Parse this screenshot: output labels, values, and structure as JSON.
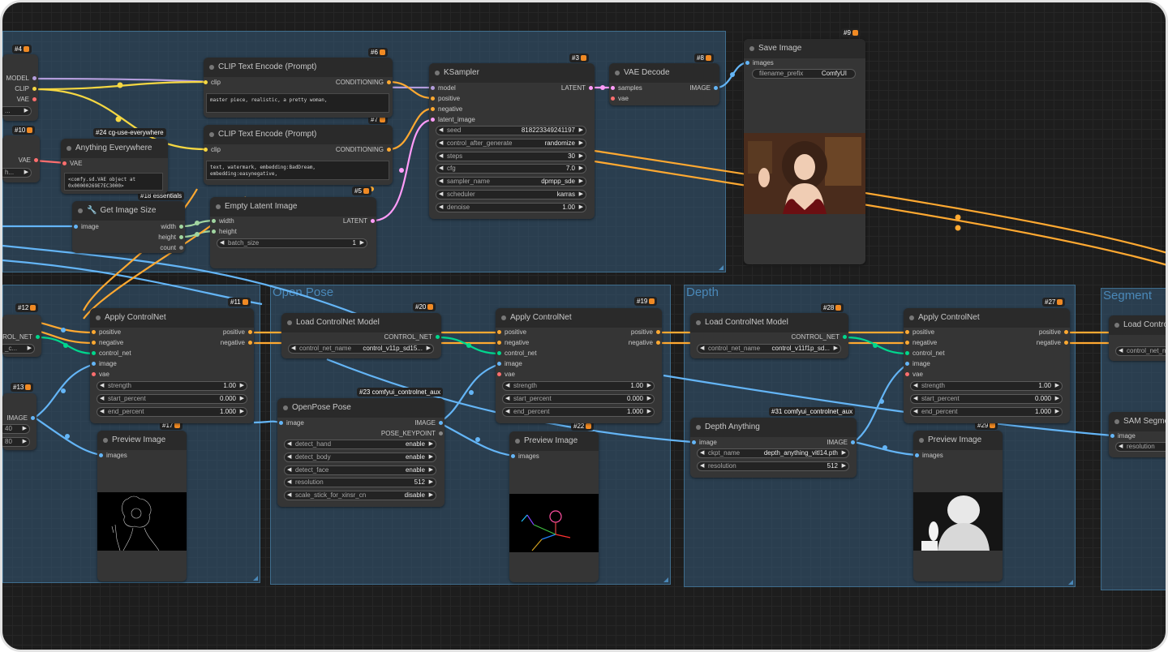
{
  "groups": {
    "openpose": "Open Pose",
    "depth": "Depth",
    "segment": "Segment"
  },
  "badges": {
    "n4": "#4",
    "n6": "#6",
    "n3": "#3",
    "n8": "#8",
    "n9": "#9",
    "n10": "#10",
    "n7": "#7",
    "n5": "#5",
    "n12": "#12",
    "n11": "#11",
    "n20": "#20",
    "n19": "#19",
    "n28": "#28",
    "n27": "#27",
    "n13": "#13",
    "n17": "#17",
    "n22": "#22",
    "n29": "#29"
  },
  "labels": {
    "cg_use_everywhere": "#24 cg-use-everywhere",
    "essentials": "#18 essentials",
    "openpose_aux": "#23 comfyui_controlnet_aux",
    "depth_aux": "#31 comfyui_controlnet_aux"
  },
  "checkpoint": {
    "model": "MODEL",
    "clip": "CLIP",
    "vae": "VAE"
  },
  "vae_loader": {
    "vae": "VAE",
    "widget": "...",
    "widget2": "h..."
  },
  "clip_pos": {
    "title": "CLIP Text Encode (Prompt)",
    "clip": "clip",
    "out": "CONDITIONING",
    "text": "master piece, realistic, a pretty woman,"
  },
  "clip_neg": {
    "title": "CLIP Text Encode (Prompt)",
    "clip": "clip",
    "out": "CONDITIONING",
    "text": "text, watermark, embedding:BadDream, embedding:easynegative,"
  },
  "anything": {
    "title": "Anything Everywhere",
    "vae": "VAE",
    "text": "<comfy.sd.VAE object at\n0x00000269E7EC3000>"
  },
  "getsize": {
    "title": "Get Image Size",
    "image": "image",
    "width": "width",
    "height": "height",
    "count": "count"
  },
  "empty_latent": {
    "title": "Empty Latent Image",
    "width": "width",
    "height": "height",
    "out": "LATENT",
    "w_label": "batch_size",
    "w_value": "1"
  },
  "ksampler": {
    "title": "KSampler",
    "model": "model",
    "positive": "positive",
    "negative": "negative",
    "latent": "latent_image",
    "out": "LATENT",
    "widgets": [
      {
        "label": "seed",
        "value": "818223349241197"
      },
      {
        "label": "control_after_generate",
        "value": "randomize"
      },
      {
        "label": "steps",
        "value": "30"
      },
      {
        "label": "cfg",
        "value": "7.0"
      },
      {
        "label": "sampler_name",
        "value": "dpmpp_sde"
      },
      {
        "label": "scheduler",
        "value": "karras"
      },
      {
        "label": "denoise",
        "value": "1.00"
      }
    ]
  },
  "vae_decode": {
    "title": "VAE Decode",
    "samples": "samples",
    "vae": "vae",
    "out": "IMAGE"
  },
  "save_image": {
    "title": "Save Image",
    "images": "images",
    "w_label": "filename_prefix",
    "w_value": "ComfyUI"
  },
  "apply1": {
    "title": "Apply ControlNet",
    "positive": "positive",
    "negative": "negative",
    "control_net": "control_net",
    "image": "image",
    "vae": "vae",
    "out_pos": "positive",
    "out_neg": "negative",
    "widgets": [
      {
        "label": "strength",
        "value": "1.00"
      },
      {
        "label": "start_percent",
        "value": "0.000"
      },
      {
        "label": "end_percent",
        "value": "1.000"
      }
    ]
  },
  "apply2": {
    "title": "Apply ControlNet",
    "positive": "positive",
    "negative": "negative",
    "control_net": "control_net",
    "image": "image",
    "vae": "vae",
    "out_pos": "positive",
    "out_neg": "negative",
    "widgets": [
      {
        "label": "strength",
        "value": "1.00"
      },
      {
        "label": "start_percent",
        "value": "0.000"
      },
      {
        "label": "end_percent",
        "value": "1.000"
      }
    ]
  },
  "apply3": {
    "title": "Apply ControlNet",
    "positive": "positive",
    "negative": "negative",
    "control_net": "control_net",
    "image": "image",
    "vae": "vae",
    "out_pos": "positive",
    "out_neg": "negative",
    "widgets": [
      {
        "label": "strength",
        "value": "1.00"
      },
      {
        "label": "start_percent",
        "value": "0.000"
      },
      {
        "label": "end_percent",
        "value": "1.000"
      }
    ]
  },
  "left_cn": {
    "out": "ROL_NET",
    "widget": "_c...",
    "image": "IMAGE",
    "w1": "40",
    "w2": "80"
  },
  "load_cn_pose": {
    "title": "Load ControlNet Model",
    "out": "CONTROL_NET",
    "w_label": "control_net_name",
    "w_value": "control_v11p_sd15..."
  },
  "load_cn_depth": {
    "title": "Load ControlNet Model",
    "out": "CONTROL_NET",
    "w_label": "control_net_name",
    "w_value": "control_v11f1p_sd..."
  },
  "load_cn_seg": {
    "title": "Load Controll",
    "w_label": "control_net_na"
  },
  "openpose": {
    "title": "OpenPose Pose",
    "image": "image",
    "out_image": "IMAGE",
    "out_kp": "POSE_KEYPOINT",
    "widgets": [
      {
        "label": "detect_hand",
        "value": "enable"
      },
      {
        "label": "detect_body",
        "value": "enable"
      },
      {
        "label": "detect_face",
        "value": "enable"
      },
      {
        "label": "resolution",
        "value": "512"
      },
      {
        "label": "scale_stick_for_xinsr_cn",
        "value": "disable"
      }
    ]
  },
  "depth_any": {
    "title": "Depth Anything",
    "image": "image",
    "out": "IMAGE",
    "widgets": [
      {
        "label": "ckpt_name",
        "value": "depth_anything_vitl14.pth"
      },
      {
        "label": "resolution",
        "value": "512"
      }
    ]
  },
  "sam": {
    "title": "SAM Segmen",
    "image": "image",
    "w_label": "resolution"
  },
  "preview1": {
    "title": "Preview Image",
    "images": "images"
  },
  "preview2": {
    "title": "Preview Image",
    "images": "images"
  },
  "preview3": {
    "title": "Preview Image",
    "images": "images"
  },
  "colors": {
    "clip": "#f5d742",
    "model": "#b39ddb",
    "vae": "#ff6e6e",
    "cond": "#ffa931",
    "latent": "#ff9cf9",
    "image": "#64b5f6",
    "cn": "#00d78d",
    "int": "#a1d6a1"
  }
}
